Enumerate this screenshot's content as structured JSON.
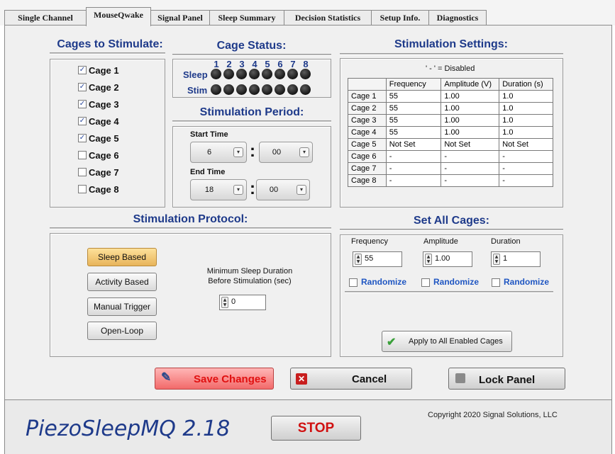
{
  "tabs": [
    {
      "label": "Single Channel"
    },
    {
      "label": "MouseQwake"
    },
    {
      "label": "Signal Panel"
    },
    {
      "label": "Sleep Summary"
    },
    {
      "label": "Decision Statistics"
    },
    {
      "label": "Setup Info."
    },
    {
      "label": "Diagnostics"
    }
  ],
  "cages_to_stimulate": {
    "title": "Cages to Stimulate:",
    "cages": [
      {
        "label": "Cage 1",
        "checked": true
      },
      {
        "label": "Cage 2",
        "checked": true
      },
      {
        "label": "Cage 3",
        "checked": true
      },
      {
        "label": "Cage 4",
        "checked": true
      },
      {
        "label": "Cage 5",
        "checked": true
      },
      {
        "label": "Cage 6",
        "checked": false
      },
      {
        "label": "Cage 7",
        "checked": false
      },
      {
        "label": "Cage 8",
        "checked": false
      }
    ]
  },
  "cage_status": {
    "title": "Cage Status:",
    "numbers": [
      "1",
      "2",
      "3",
      "4",
      "5",
      "6",
      "7",
      "8"
    ],
    "sleep_label": "Sleep",
    "stim_label": "Stim",
    "led_color": "#1a1a1a"
  },
  "stimulation_period": {
    "title": "Stimulation Period:",
    "start_label": "Start Time",
    "start_hour": "6",
    "start_minute": "00",
    "end_label": "End Time",
    "end_hour": "18",
    "end_minute": "00",
    "separator": ":"
  },
  "stimulation_settings": {
    "title": "Stimulation Settings:",
    "note": "' - ' = Disabled",
    "columns": [
      "Frequency",
      "Amplitude (V)",
      "Duration (s)"
    ],
    "rows": [
      {
        "cage": "Cage 1",
        "frequency": "55",
        "amplitude": "1.00",
        "duration": "1.0"
      },
      {
        "cage": "Cage 2",
        "frequency": "55",
        "amplitude": "1.00",
        "duration": "1.0"
      },
      {
        "cage": "Cage 3",
        "frequency": "55",
        "amplitude": "1.00",
        "duration": "1.0"
      },
      {
        "cage": "Cage 4",
        "frequency": "55",
        "amplitude": "1.00",
        "duration": "1.0"
      },
      {
        "cage": "Cage 5",
        "frequency": "Not Set",
        "amplitude": "Not Set",
        "duration": "Not Set"
      },
      {
        "cage": "Cage 6",
        "frequency": "-",
        "amplitude": "-",
        "duration": "-"
      },
      {
        "cage": "Cage 7",
        "frequency": "-",
        "amplitude": "-",
        "duration": "-"
      },
      {
        "cage": "Cage 8",
        "frequency": "-",
        "amplitude": "-",
        "duration": "-"
      }
    ]
  },
  "stimulation_protocol": {
    "title": "Stimulation Protocol:",
    "buttons": [
      {
        "label": "Sleep Based",
        "selected": true
      },
      {
        "label": "Activity Based",
        "selected": false
      },
      {
        "label": "Manual Trigger",
        "selected": false
      },
      {
        "label": "Open-Loop",
        "selected": false
      }
    ],
    "min_sleep_label_line1": "Minimum Sleep Duration",
    "min_sleep_label_line2": "Before Stimulation (sec)",
    "min_sleep_value": "0"
  },
  "set_all_cages": {
    "title": "Set All Cages:",
    "frequency_label": "Frequency",
    "frequency_value": "55",
    "amplitude_label": "Amplitude",
    "amplitude_value": "1.00",
    "duration_label": "Duration",
    "duration_value": "1",
    "randomize_label": "Randomize",
    "apply_label": "Apply to All Enabled Cages"
  },
  "actions": {
    "save_label": "Save Changes",
    "cancel_label": "Cancel",
    "lock_label": "Lock Panel"
  },
  "footer": {
    "app_title": "PiezoSleepMQ 2.18",
    "stop_label": "STOP",
    "copyright": "Copyright 2020 Signal Solutions, LLC"
  },
  "colors": {
    "heading": "#1e3a8a",
    "selected_button": "#f2c26a",
    "save_text": "#e01010",
    "cancel_icon": "#c81e1e",
    "stop_text": "#d01010",
    "randomize": "#1f56c2"
  }
}
